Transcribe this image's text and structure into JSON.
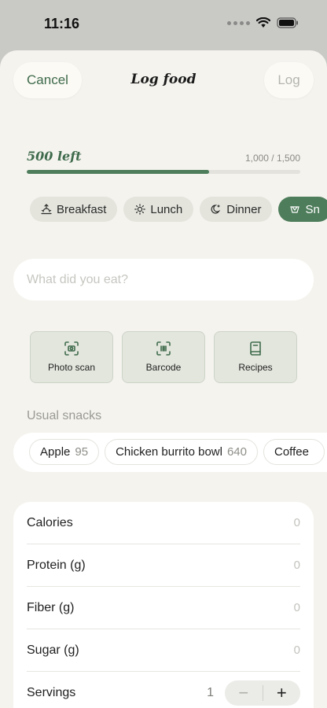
{
  "status": {
    "time": "11:16"
  },
  "header": {
    "cancel_label": "Cancel",
    "title": "Log food",
    "log_label": "Log"
  },
  "budget": {
    "left_text": "500 left",
    "progress_text": "1,000 / 1,500",
    "progress_fraction": 0.667
  },
  "meals": [
    {
      "label": "Breakfast",
      "icon": "sunrise-icon"
    },
    {
      "label": "Lunch",
      "icon": "sun-icon"
    },
    {
      "label": "Dinner",
      "icon": "moon-icon"
    },
    {
      "label": "Sn",
      "icon": "snack-icon",
      "active": true
    }
  ],
  "search": {
    "placeholder": "What did you eat?"
  },
  "actions": [
    {
      "label": "Photo scan",
      "icon": "camera-scan-icon"
    },
    {
      "label": "Barcode",
      "icon": "barcode-icon"
    },
    {
      "label": "Recipes",
      "icon": "book-icon"
    }
  ],
  "snacks": {
    "title": "Usual snacks",
    "items": [
      {
        "name": "Apple",
        "cal": "95"
      },
      {
        "name": "Chicken burrito bowl",
        "cal": "640"
      },
      {
        "name": "Coffee",
        "cal": ""
      }
    ]
  },
  "nutrition": {
    "rows": [
      {
        "label": "Calories",
        "value": "0"
      },
      {
        "label": "Protein (g)",
        "value": "0"
      },
      {
        "label": "Fiber (g)",
        "value": "0"
      },
      {
        "label": "Sugar (g)",
        "value": "0"
      }
    ],
    "servings": {
      "label": "Servings",
      "value": "1",
      "minus": "−",
      "plus": "+"
    }
  },
  "colors": {
    "accent": "#4e7d5b",
    "sheet_bg": "#f4f3ee"
  }
}
